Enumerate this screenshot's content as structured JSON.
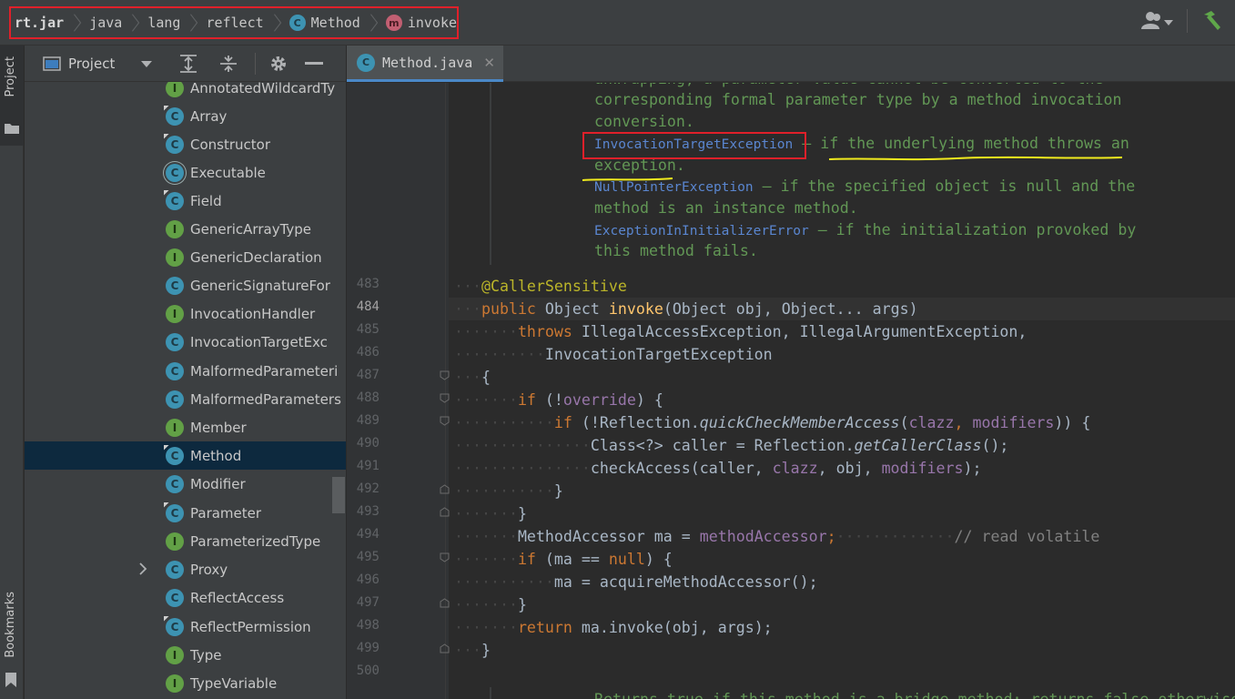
{
  "breadcrumb": {
    "items": [
      {
        "label": "rt.jar",
        "icon": null
      },
      {
        "label": "java",
        "icon": null
      },
      {
        "label": "lang",
        "icon": null
      },
      {
        "label": "reflect",
        "icon": null
      },
      {
        "label": "Method",
        "icon": "C"
      },
      {
        "label": "invoke",
        "icon": "m"
      }
    ]
  },
  "toolstrip": {
    "project": "Project",
    "bookmarks": "Bookmarks"
  },
  "project_panel": {
    "title": "Project",
    "items": [
      {
        "icon": "I",
        "label": "AnnotatedWildcardTy"
      },
      {
        "icon": "C",
        "label": "Array"
      },
      {
        "icon": "C",
        "label": "Constructor"
      },
      {
        "icon": "C",
        "label": "Executable"
      },
      {
        "icon": "C",
        "label": "Field"
      },
      {
        "icon": "I",
        "label": "GenericArrayType"
      },
      {
        "icon": "I",
        "label": "GenericDeclaration"
      },
      {
        "icon": "C",
        "label": "GenericSignatureFor"
      },
      {
        "icon": "I",
        "label": "InvocationHandler"
      },
      {
        "icon": "C",
        "label": "InvocationTargetExc"
      },
      {
        "icon": "C",
        "label": "MalformedParameteri"
      },
      {
        "icon": "C",
        "label": "MalformedParameters"
      },
      {
        "icon": "I",
        "label": "Member"
      },
      {
        "icon": "C",
        "label": "Method"
      },
      {
        "icon": "C",
        "label": "Modifier"
      },
      {
        "icon": "C",
        "label": "Parameter"
      },
      {
        "icon": "I",
        "label": "ParameterizedType"
      },
      {
        "icon": "C",
        "label": "Proxy"
      },
      {
        "icon": "C",
        "label": "ReflectAccess"
      },
      {
        "icon": "C",
        "label": "ReflectPermission"
      },
      {
        "icon": "I",
        "label": "Type"
      },
      {
        "icon": "I",
        "label": "TypeVariable"
      }
    ]
  },
  "tab": {
    "label": "Method.java",
    "icon": "C"
  },
  "doc": {
    "line0": "unwrapping, a parameter value cannot be converted to the",
    "line1": "corresponding formal parameter type by a method invocation",
    "line2": "conversion.",
    "ite_link": "InvocationTargetException",
    "ite_text": " – if the underlying method throws an",
    "ite_text2": "exception.",
    "npe_link": "NullPointerException",
    "npe_text": " – if the specified object is null and the",
    "npe_text2": "method is an instance method.",
    "eiie_link": "ExceptionInInitializerError",
    "eiie_text": " – if the initialization provoked by",
    "eiie_text2": "this method fails.",
    "bottom": "Returns true if this method is a bridge method; returns false otherwise."
  },
  "lines": {
    "n483": "483",
    "n484": "484",
    "n485": "485",
    "n486": "486",
    "n487": "487",
    "n488": "488",
    "n489": "489",
    "n490": "490",
    "n491": "491",
    "n492": "492",
    "n493": "493",
    "n494": "494",
    "n495": "495",
    "n496": "496",
    "n497": "497",
    "n498": "498",
    "n499": "499",
    "n500": "500"
  },
  "code": {
    "annotation": "@CallerSensitive",
    "public": "public",
    "object": " Object ",
    "invoke": "invoke",
    "sig_rest": "(Object obj, Object... args)",
    "throws": "throws",
    "throws_rest": " IllegalAccessException, IllegalArgumentException,",
    "ite": "InvocationTargetException",
    "brace_open": "{",
    "if": "if",
    "paren_not": " (!",
    "override": "override",
    "close_brace_open": ") {",
    "if2": "if",
    "refl": " (!Reflection.",
    "qcma": "quickCheckMemberAccess",
    "open": "(",
    "clazz": "clazz",
    "comma": ", ",
    "modifiers": "modifiers",
    "close2": ")) {",
    "class_caller": "Class<?> caller = Reflection.",
    "gcc": "getCallerClass",
    "gcc_end": "();",
    "check": "checkAccess(caller, ",
    "obj_comma": ", obj, ",
    "end_call": ");",
    "close_brace": "}",
    "ma_decl": "MethodAccessor ma = ",
    "methodAccessor": "methodAccessor",
    "semicolon": ";",
    "comment": "// read volatile",
    "if3": "if",
    "ma_eq": " (ma == ",
    "null": "null",
    "paren_brace": ") {",
    "acquire": "ma = acquireMethodAccessor();",
    "return": "return",
    "return_rest": " ma.invoke(obj, args);"
  },
  "colors": {
    "highlight": "#e0202a",
    "underline": "#f2ec1e",
    "keyword": "#cc7832",
    "doc": "#629755"
  }
}
